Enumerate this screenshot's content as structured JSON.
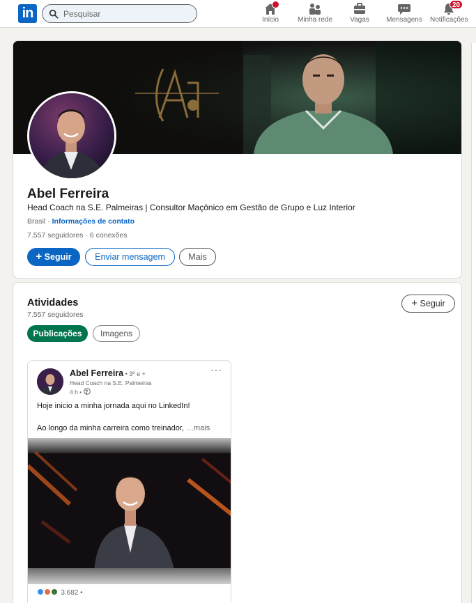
{
  "nav": {
    "logo": "in",
    "search_placeholder": "Pesquisar",
    "items": [
      {
        "label": "Início",
        "icon": "home-icon"
      },
      {
        "label": "Minha rede",
        "icon": "network-icon"
      },
      {
        "label": "Vagas",
        "icon": "briefcase-icon"
      },
      {
        "label": "Mensagens",
        "icon": "messaging-icon"
      },
      {
        "label": "Notificações",
        "icon": "bell-icon",
        "badge": "20"
      }
    ]
  },
  "profile": {
    "name": "Abel Ferreira",
    "headline": "Head Coach na S.E. Palmeiras | Consultor Maçônico em Gestão de Grupo e Luz Interior",
    "location": "Brasil",
    "location_sep": " · ",
    "contact_link": "Informações de contato",
    "followers": "7.557 seguidores",
    "connections": " · 6 conexões",
    "follow_button": "Seguir",
    "message_button": "Enviar mensagem",
    "more_button": "Mais"
  },
  "activity": {
    "title": "Atividades",
    "followers": "7.557 seguidores",
    "follow_button": "Seguir",
    "tabs": [
      {
        "label": "Publicações",
        "active": true
      },
      {
        "label": "Imagens",
        "active": false
      }
    ],
    "post": {
      "author": "Abel Ferreira",
      "degree": " • 3º e +",
      "subtitle": "Head Coach na S.E. Palmeiras",
      "time": "4 h •",
      "more_menu": "···",
      "text_line1": "Hoje inicio a minha jornada aqui no LinkedIn!",
      "text_line2": "Ao longo da minha carreira como treinador, ",
      "see_more": "…mais",
      "reactions_count": "3.682 •"
    }
  },
  "colors": {
    "brand": "#0a66c2",
    "active_tab": "#01754f",
    "badge": "#cb112d"
  }
}
